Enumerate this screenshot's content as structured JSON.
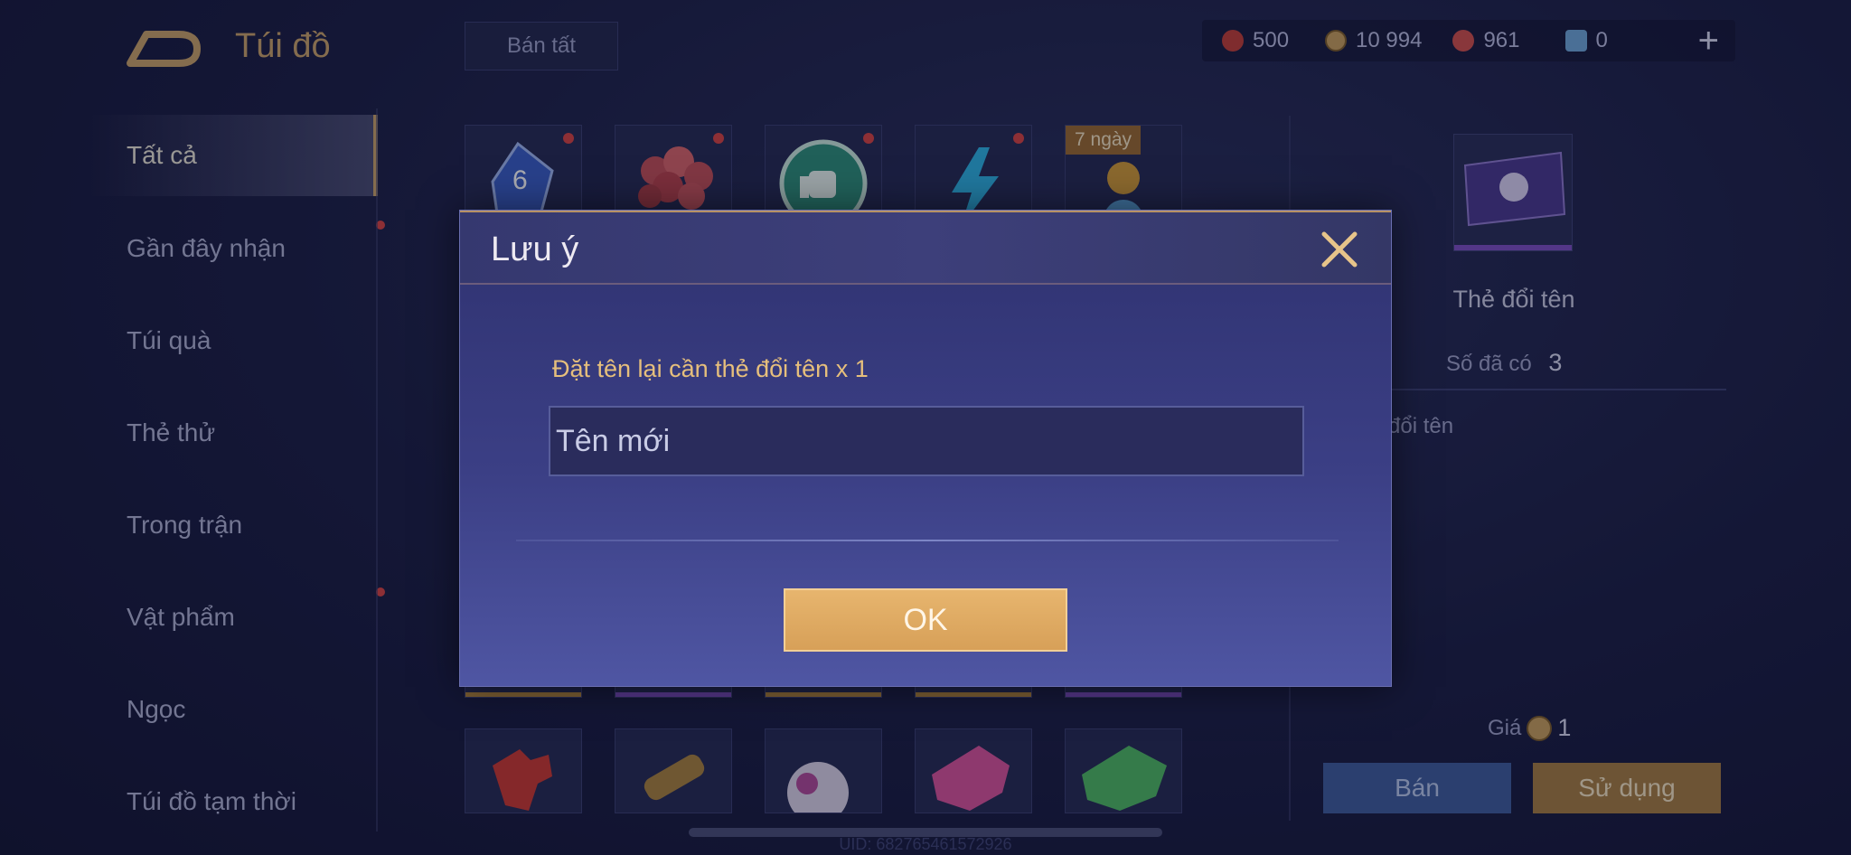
{
  "header": {
    "title": "Túi đồ",
    "sell_all": "Bán tất"
  },
  "currencies": [
    {
      "icon": "voucher-icon",
      "value": "500",
      "color": "#c0403a"
    },
    {
      "icon": "gold-coin-icon",
      "value": "10 994",
      "color": "#c69e5e"
    },
    {
      "icon": "ruby-icon",
      "value": "961",
      "color": "#d0504e"
    },
    {
      "icon": "card-icon",
      "value": "0",
      "color": "#6fa6d9"
    }
  ],
  "plus": "+",
  "sidebar": {
    "items": [
      {
        "label": "Tất cả"
      },
      {
        "label": "Gần đây nhận"
      },
      {
        "label": "Túi quà"
      },
      {
        "label": "Thẻ thử"
      },
      {
        "label": "Trong trận"
      },
      {
        "label": "Vật phẩm"
      },
      {
        "label": "Ngọc"
      },
      {
        "label": "Túi đồ tạm thời"
      }
    ]
  },
  "grid": {
    "badge": "7 ngày",
    "row1_icons": [
      "dice-icon",
      "rose-bouquet-icon",
      "thumbs-up-icon",
      "lightning-icon",
      "potion-icon"
    ],
    "row3_icons": [
      "red-puzzle-icon",
      "scroll-icon",
      "soccer-ball-icon",
      "pink-puzzle-icon",
      "green-puzzle-icon"
    ]
  },
  "detail": {
    "name": "Thẻ đổi tên",
    "owned_label": "Số đã có",
    "owned_value": "3",
    "description": "đổi tên",
    "price_label": "Giá",
    "price_value": "1",
    "sell": "Bán",
    "use": "Sử dụng"
  },
  "uid": "UID: 682765461572926",
  "dialog": {
    "title": "Lưu ý",
    "message": "Đặt tên lại cần thẻ đổi tên x 1",
    "input_placeholder": "Tên mới",
    "ok": "OK"
  }
}
